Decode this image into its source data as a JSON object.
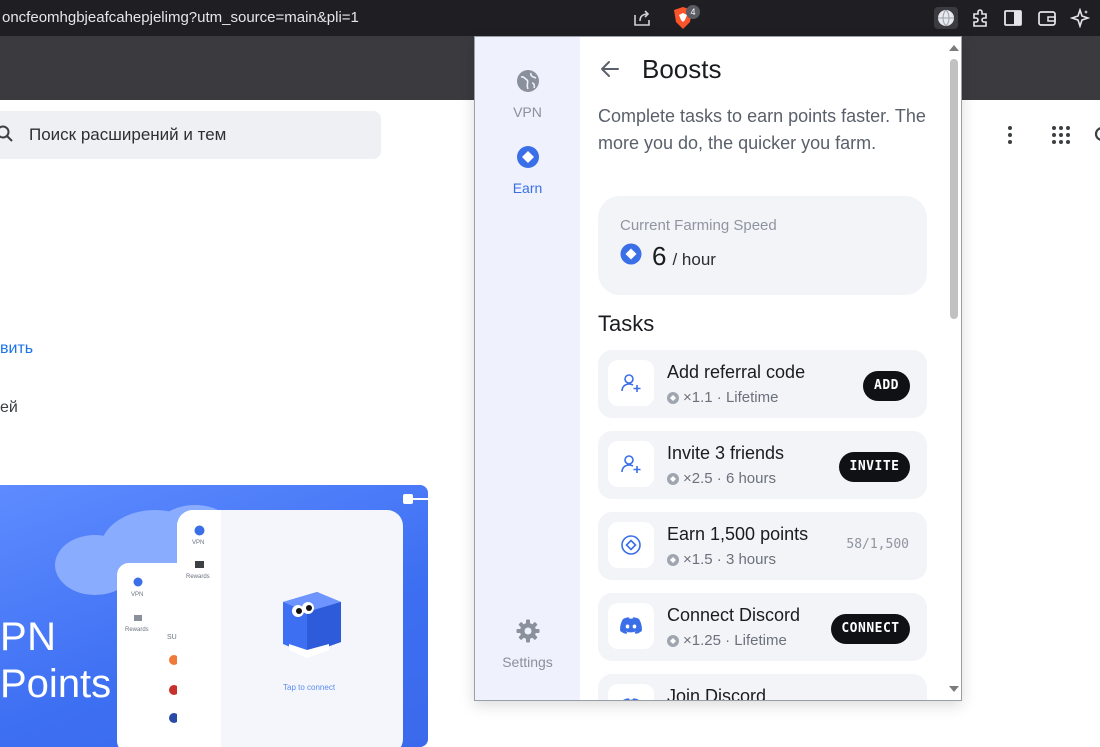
{
  "browser": {
    "url": "oncfeomhgbjeafcahepjelimg?utm_source=main&pli=1",
    "brave_badge": "4",
    "toolbar_icons": [
      "globe-icon",
      "puzzle-icon",
      "sidebar-icon",
      "wallet-icon",
      "sparkle-icon"
    ]
  },
  "store": {
    "search_placeholder": "Поиск расширений и тем",
    "link_text": "вить",
    "misc_text": "ей",
    "promo_title_line1": "PN",
    "promo_title_line2": "Points",
    "mock_vpn_label": "VPN",
    "mock_rewards_label": "Rewards",
    "mock_rewards_label_2": "Rewards",
    "mock_tap_text": "Tap to connect",
    "mock_su_text": "SU"
  },
  "popup": {
    "sidebar": {
      "vpn_label": "VPN",
      "earn_label": "Earn",
      "settings_label": "Settings"
    },
    "title": "Boosts",
    "description": "Complete tasks to earn points faster. The more you do, the quicker you farm.",
    "speed": {
      "label": "Current Farming Speed",
      "value": "6",
      "unit": "/ hour"
    },
    "tasks_title": "Tasks",
    "tasks": [
      {
        "name": "Add referral code",
        "meta": "×1.1 · Lifetime",
        "button": "ADD",
        "icon": "user-plus-icon"
      },
      {
        "name": "Invite 3 friends",
        "meta": "×2.5 · 6 hours",
        "button": "INVITE",
        "icon": "user-plus-icon"
      },
      {
        "name": "Earn 1,500 points",
        "meta": "×1.5 · 3 hours",
        "progress": "58/1,500",
        "icon": "target-gem-icon"
      },
      {
        "name": "Connect Discord",
        "meta": "×1.25 · Lifetime",
        "button": "CONNECT",
        "icon": "discord-icon"
      },
      {
        "name": "Join Discord",
        "icon": "discord-icon"
      }
    ]
  },
  "colors": {
    "accent": "#3a6fe8",
    "sidebar_bg": "#eff2fc",
    "card_bg": "#f3f4f8",
    "button_bg": "#0f1115",
    "chrome_bg": "#1f1f23"
  }
}
